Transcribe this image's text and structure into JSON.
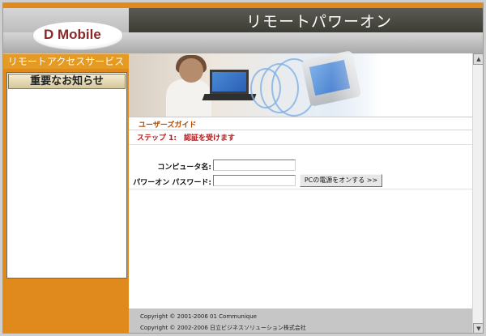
{
  "header": {
    "logo_text": "D Mobile",
    "title": "リモートパワーオン"
  },
  "sidebar": {
    "service_title": "リモートアクセスサービス",
    "notice_title": "重要なお知らせ"
  },
  "main": {
    "guide_link": "ユーザーズガイド",
    "step_text": "ステップ 1:　認証を受けます",
    "computer_name_label": "コンピュータ名:",
    "computer_name_value": "",
    "password_label": "パワーオン パスワード:",
    "password_value": "",
    "power_on_button": "PCの電源をオンする >>"
  },
  "footer": {
    "copyright1": "Copyright © 2001-2006 01 Communique",
    "copyright2": "Copyright © 2002-2006 日立ビジネスソリューション株式会社"
  },
  "colors": {
    "accent_orange": "#e08a1e",
    "header_dark": "#4a4a42",
    "step_red": "#b11a1a"
  }
}
